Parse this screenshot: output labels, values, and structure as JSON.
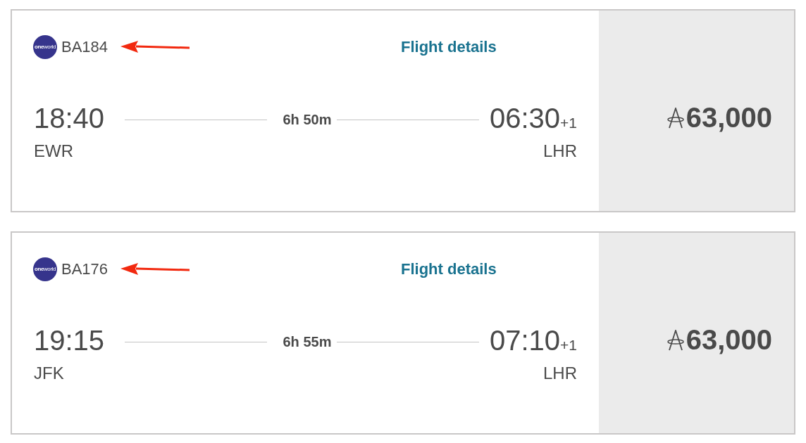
{
  "flights": [
    {
      "logo": {
        "text": "**one**world"
      },
      "flight_number": "BA184",
      "details_link": "Flight details",
      "departure": {
        "time": "18:40",
        "airport": "EWR"
      },
      "duration": "6h 50m",
      "arrival": {
        "time": "06:30",
        "day_offset": "+1",
        "airport": "LHR"
      },
      "price": "63,000"
    },
    {
      "logo": {
        "text": "**one**world"
      },
      "flight_number": "BA176",
      "details_link": "Flight details",
      "departure": {
        "time": "19:15",
        "airport": "JFK"
      },
      "duration": "6h 55m",
      "arrival": {
        "time": "07:10",
        "day_offset": "+1",
        "airport": "LHR"
      },
      "price": "63,000"
    }
  ]
}
